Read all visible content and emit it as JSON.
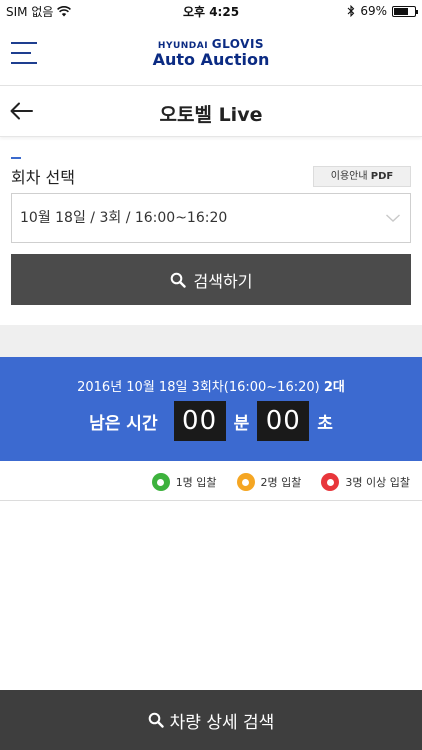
{
  "status_bar": {
    "carrier": "SIM 없음",
    "time": "오후 4:25",
    "battery": "69%",
    "battery_level": 0.69
  },
  "header": {
    "logo_brand": "HYUNDAI",
    "logo_name": "GLOVIS",
    "logo_subtitle": "Auto Auction"
  },
  "page": {
    "title": "오토벨 Live"
  },
  "round_select": {
    "label": "회차 선택",
    "guide_prefix": "이용안내",
    "guide_suffix": "PDF",
    "selected_value": "10월 18일 / 3회 / 16:00~16:20",
    "search_label": "검색하기"
  },
  "timer": {
    "info_text": "2016년 10월 18일 3회차(16:00~16:20)",
    "info_count": "2대",
    "remaining_label": "남은 시간",
    "minutes": "00",
    "minute_unit": "분",
    "seconds": "00",
    "second_unit": "초"
  },
  "legend": [
    {
      "label": "1명 입찰",
      "color": "#3db23d"
    },
    {
      "label": "2명 입찰",
      "color": "#f5a623"
    },
    {
      "label": "3명 이상 입찰",
      "color": "#e8363b"
    }
  ],
  "footer": {
    "detail_search_label": "차량 상세 검색"
  },
  "icons": {
    "menu": "hamburger-menu-icon",
    "back": "arrow-left-icon",
    "dropdown": "chevron-down-icon",
    "search": "search-icon",
    "wifi": "wifi-icon",
    "bluetooth": "bluetooth-icon",
    "battery": "battery-icon"
  },
  "colors": {
    "brand_navy": "#0b2b83",
    "timer_blue": "#3c6ad0",
    "button_dark": "#4b4b4b"
  }
}
